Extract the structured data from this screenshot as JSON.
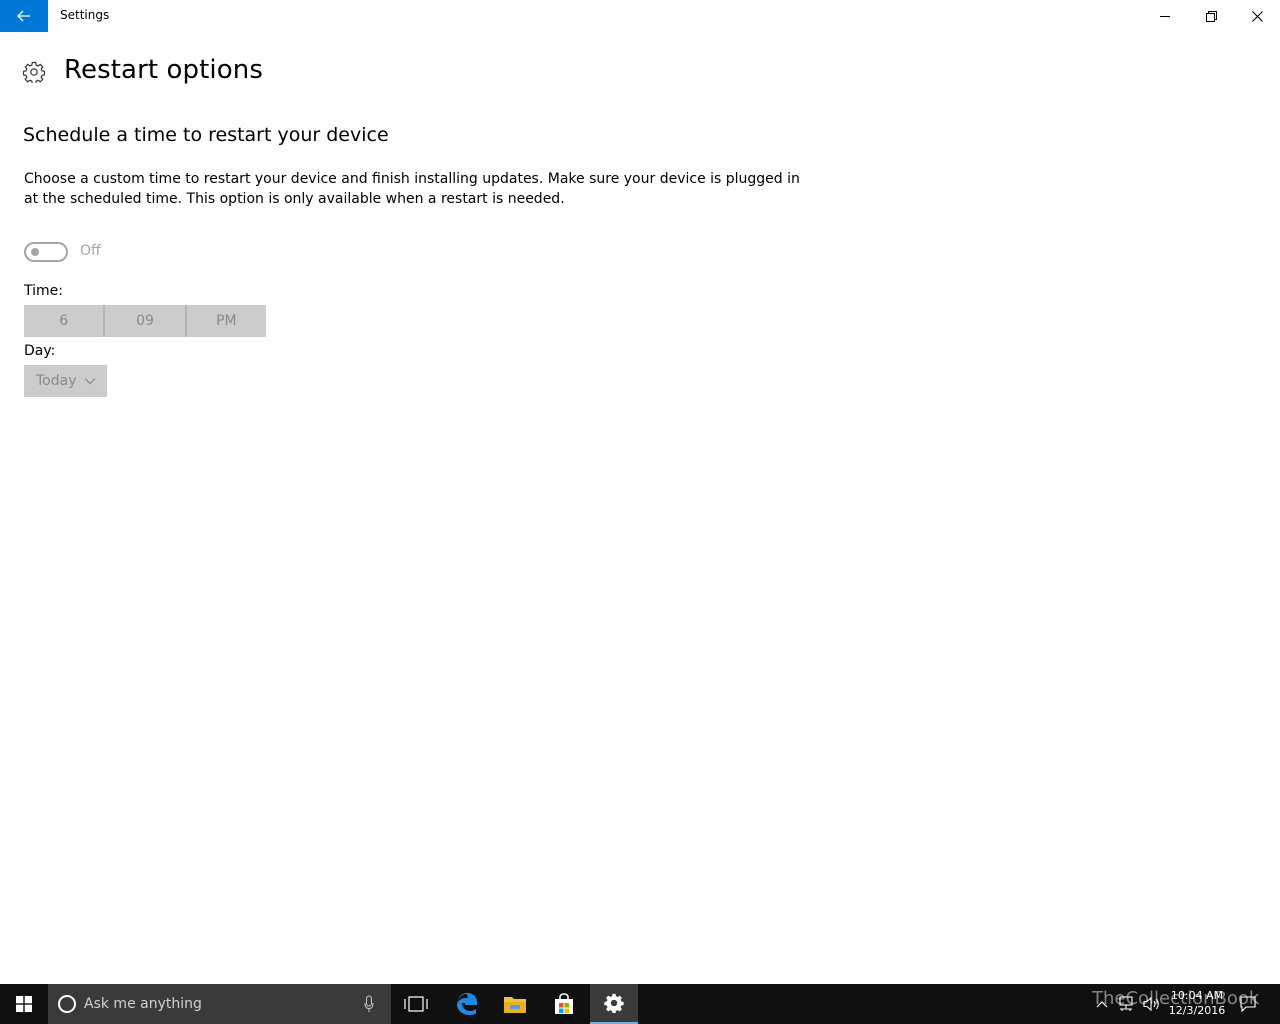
{
  "window": {
    "title": "Settings"
  },
  "page": {
    "title": "Restart options",
    "section_title": "Schedule a time to restart your device",
    "description": "Choose a custom time to restart your device and finish installing updates. Make sure your device is plugged in at the scheduled time. This option is only available when a restart is needed."
  },
  "toggle": {
    "state_label": "Off",
    "on": false
  },
  "time": {
    "label": "Time:",
    "hour": "6",
    "minute": "09",
    "period": "PM"
  },
  "day": {
    "label": "Day:",
    "selected": "Today"
  },
  "taskbar": {
    "search_placeholder": "Ask me anything",
    "clock_time": "10:04 AM",
    "clock_date": "12/3/2016",
    "watermark": "TheCollectionBook"
  },
  "colors": {
    "accent": "#0078d7",
    "disabled_control": "#cccccc",
    "disabled_text": "#8a8a8a",
    "taskbar": "#101010"
  },
  "icons": [
    "back-arrow-icon",
    "minimize-icon",
    "restore-icon",
    "close-icon",
    "gear-icon",
    "chevron-down-icon",
    "windows-logo-icon",
    "cortana-icon",
    "microphone-icon",
    "task-view-icon",
    "edge-icon",
    "file-explorer-icon",
    "store-icon",
    "settings-gear-icon",
    "tray-chevron-icon",
    "network-icon",
    "volume-icon",
    "action-center-icon"
  ]
}
